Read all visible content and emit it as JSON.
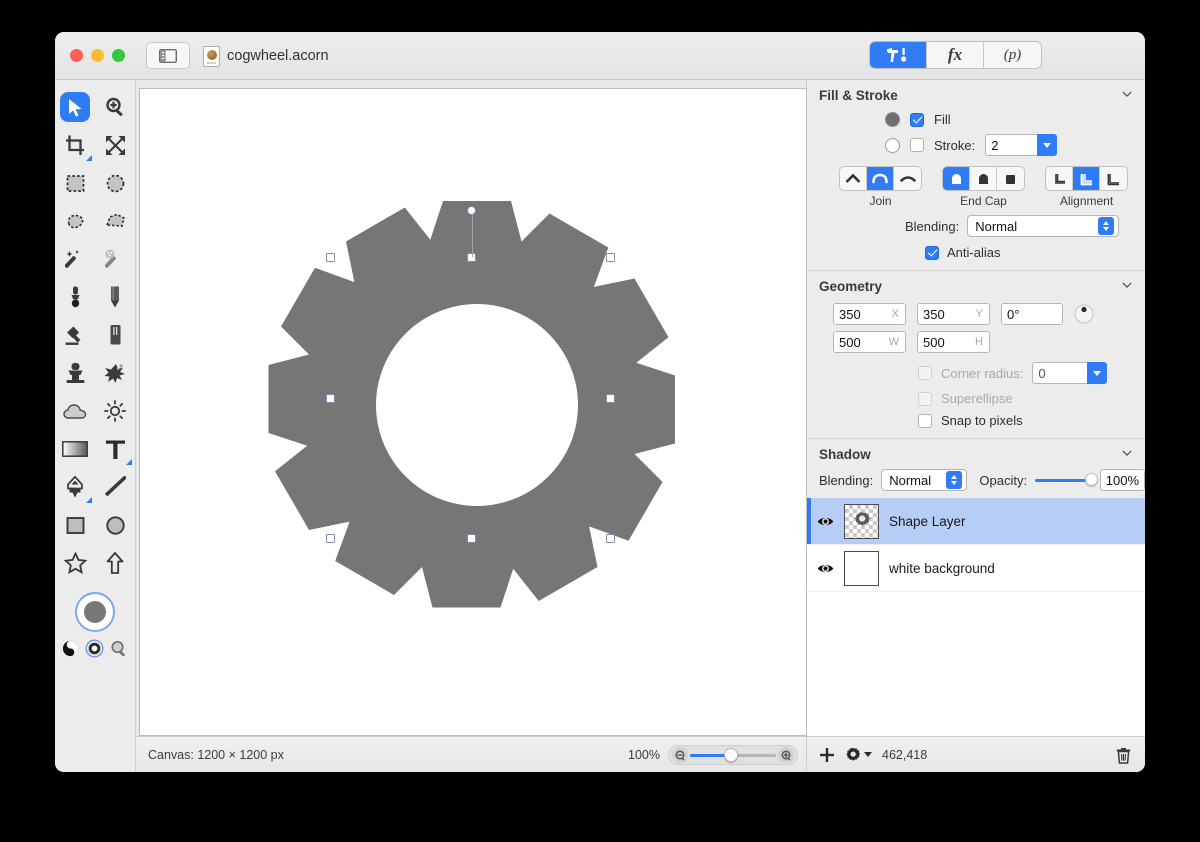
{
  "window": {
    "document_title": "cogwheel.acorn",
    "traffic_lights": [
      "close-button",
      "minimize-button",
      "maximize-button"
    ],
    "sidebar_toggle_icon": "sidebar-toggle-icon",
    "document_icon": "acorn-document-icon",
    "document_icon_label": "Acorn"
  },
  "inspector_tabs": [
    {
      "id": "tools",
      "label": "",
      "icon": "hammer-tool-icon",
      "active": true
    },
    {
      "id": "filters",
      "label": "fx",
      "icon": "fx-icon",
      "active": false
    },
    {
      "id": "presets",
      "label": "(p)",
      "icon": "presets-icon",
      "active": false
    }
  ],
  "tools": [
    {
      "name": "move-tool",
      "icon": "cursor-arrow-icon",
      "selected": true,
      "corner": false
    },
    {
      "name": "zoom-tool",
      "icon": "magnifier-plus-icon",
      "selected": false,
      "corner": false
    },
    {
      "name": "crop-tool",
      "icon": "crop-icon",
      "selected": false,
      "corner": true
    },
    {
      "name": "transform-tool",
      "icon": "move-arrows-icon",
      "selected": false,
      "corner": false
    },
    {
      "name": "rectangular-marquee-tool",
      "icon": "rect-marquee-icon",
      "selected": false,
      "corner": false
    },
    {
      "name": "elliptical-marquee-tool",
      "icon": "ellipse-marquee-icon",
      "selected": false,
      "corner": false
    },
    {
      "name": "lasso-tool",
      "icon": "lasso-icon",
      "selected": false,
      "corner": false
    },
    {
      "name": "polygon-lasso-tool",
      "icon": "polygon-lasso-icon",
      "selected": false,
      "corner": false
    },
    {
      "name": "magic-wand-tool",
      "icon": "magic-wand-icon",
      "selected": false,
      "corner": false
    },
    {
      "name": "instant-alpha-tool",
      "icon": "sparkle-wand-icon",
      "selected": false,
      "corner": false
    },
    {
      "name": "brush-tool",
      "icon": "brush-icon",
      "selected": false,
      "corner": false
    },
    {
      "name": "pencil-tool",
      "icon": "pencil-icon",
      "selected": false,
      "corner": false
    },
    {
      "name": "paint-bucket-tool",
      "icon": "paint-bucket-icon",
      "selected": false,
      "corner": false
    },
    {
      "name": "eraser-tool",
      "icon": "eraser-icon",
      "selected": false,
      "corner": false
    },
    {
      "name": "clone-stamp-tool",
      "icon": "clone-stamp-icon",
      "selected": false,
      "corner": false
    },
    {
      "name": "smudge-tool",
      "icon": "smudge-burst-icon",
      "selected": false,
      "corner": false
    },
    {
      "name": "blur-tool",
      "icon": "cloud-icon",
      "selected": false,
      "corner": false
    },
    {
      "name": "dodge-tool",
      "icon": "sun-icon",
      "selected": false,
      "corner": false
    },
    {
      "name": "gradient-tool",
      "icon": "gradient-icon",
      "selected": false,
      "corner": false
    },
    {
      "name": "text-tool",
      "icon": "text-t-icon",
      "selected": false,
      "corner": true
    },
    {
      "name": "pen-tool",
      "icon": "pen-nib-icon",
      "selected": false,
      "corner": true
    },
    {
      "name": "line-tool",
      "icon": "line-icon",
      "selected": false,
      "corner": false
    },
    {
      "name": "rectangle-tool",
      "icon": "rectangle-icon",
      "selected": false,
      "corner": false
    },
    {
      "name": "ellipse-tool",
      "icon": "ellipse-icon",
      "selected": false,
      "corner": false
    },
    {
      "name": "star-tool",
      "icon": "star-icon",
      "selected": false,
      "corner": false
    },
    {
      "name": "arrow-tool",
      "icon": "arrow-up-icon",
      "selected": false,
      "corner": false
    }
  ],
  "color_well": {
    "name": "foreground-color-well",
    "fill_color": "#777777"
  },
  "color_mini": [
    {
      "name": "invert-colors-icon"
    },
    {
      "name": "color-picker-circle-icon",
      "selected": true
    },
    {
      "name": "zoom-magnifier-icon"
    }
  ],
  "fill_stroke": {
    "title": "Fill & Stroke",
    "collapse_icon": "chevron-down-icon",
    "fill": {
      "label": "Fill",
      "checked": true,
      "swatch_name": "fill-color-swatch",
      "swatch_color": "#6f6f6f"
    },
    "stroke": {
      "label": "Stroke:",
      "checked": false,
      "swatch_name": "stroke-color-swatch",
      "swatch_color": "#ffffff",
      "width": "2"
    },
    "join": {
      "label": "Join",
      "options": [
        {
          "name": "join-miter-button",
          "icon": "miter-join-icon",
          "selected": false
        },
        {
          "name": "join-round-button",
          "icon": "round-join-icon",
          "selected": true
        },
        {
          "name": "join-bevel-button",
          "icon": "bevel-join-icon",
          "selected": false
        }
      ]
    },
    "end_cap": {
      "label": "End Cap",
      "options": [
        {
          "name": "cap-round-button",
          "icon": "round-cap-icon",
          "selected": true
        },
        {
          "name": "cap-butt-button",
          "icon": "butt-cap-icon",
          "selected": false
        },
        {
          "name": "cap-square-button",
          "icon": "square-cap-icon",
          "selected": false
        }
      ]
    },
    "alignment": {
      "label": "Alignment",
      "options": [
        {
          "name": "align-inside-button",
          "icon": "align-inside-icon",
          "selected": false
        },
        {
          "name": "align-center-button",
          "icon": "align-center-icon",
          "selected": true
        },
        {
          "name": "align-outside-button",
          "icon": "align-outside-icon",
          "selected": false
        }
      ]
    },
    "blending": {
      "label": "Blending:",
      "value": "Normal"
    },
    "anti_alias": {
      "label": "Anti-alias",
      "checked": true
    }
  },
  "geometry": {
    "title": "Geometry",
    "collapse_icon": "chevron-down-icon",
    "x": {
      "value": "350",
      "unit": "X"
    },
    "y": {
      "value": "350",
      "unit": "Y"
    },
    "rotation": {
      "value": "0°"
    },
    "rotation_knob_icon": "rotation-dial-icon",
    "w": {
      "value": "500",
      "unit": "W"
    },
    "h": {
      "value": "500",
      "unit": "H"
    },
    "corner_radius": {
      "label": "Corner radius:",
      "checked": false,
      "value": "0",
      "disabled": true
    },
    "superellipse": {
      "label": "Superellipse",
      "checked": false,
      "disabled": true
    },
    "snap_to_pixels": {
      "label": "Snap to pixels",
      "checked": false,
      "disabled": false
    }
  },
  "shadow": {
    "title": "Shadow",
    "collapse_icon": "chevron-down-icon",
    "blending": {
      "label": "Blending:",
      "value": "Normal"
    },
    "opacity": {
      "label": "Opacity:",
      "value": "100%",
      "percent": 100
    }
  },
  "layers": [
    {
      "name": "Shape Layer",
      "visible": true,
      "selected": true,
      "thumb": "gear-thumbnail",
      "transparent": true
    },
    {
      "name": "white background",
      "visible": true,
      "selected": false,
      "thumb": "white-thumbnail",
      "transparent": false
    }
  ],
  "layer_footer": {
    "add_icon": "plus-icon",
    "settings_icon": "gear-dropdown-icon",
    "doc_size": "462,418",
    "delete_icon": "trash-icon"
  },
  "statusbar": {
    "canvas_size": "Canvas: 1200 × 1200 px",
    "zoom_percent": "100%",
    "zoom_out_icon": "zoom-out-icon",
    "zoom_in_icon": "zoom-in-icon"
  },
  "canvas": {
    "shape_name": "cogwheel-shape",
    "shape_fill": "#767676",
    "teeth": 12,
    "selection_handles": 8,
    "rotation_handle": true
  }
}
